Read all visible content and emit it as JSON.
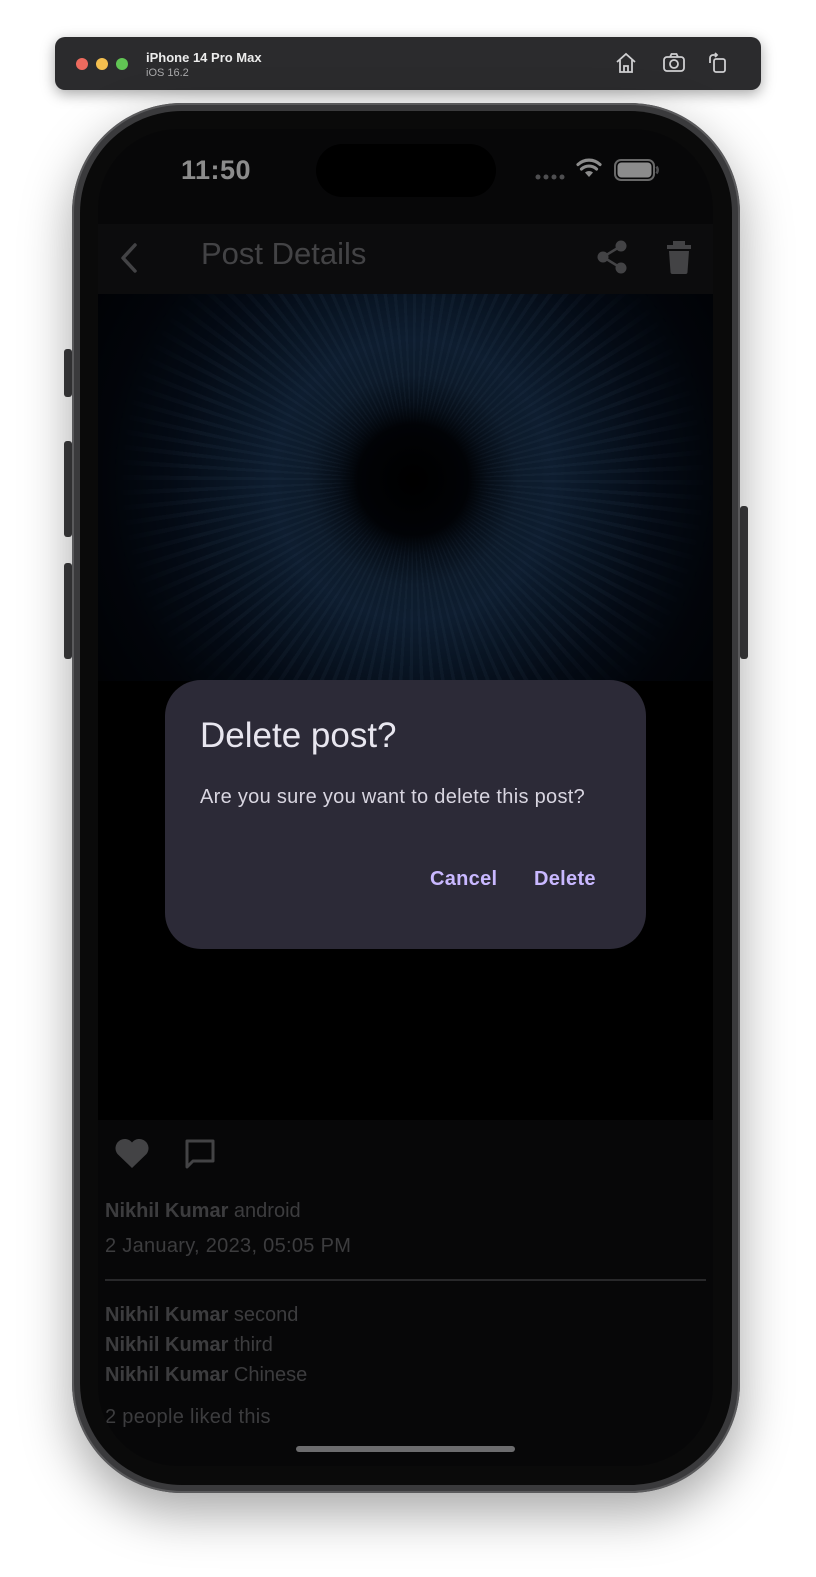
{
  "simulator": {
    "device_name": "iPhone 14 Pro Max",
    "os_version": "iOS 16.2",
    "icons": [
      "home-icon",
      "screenshot-icon",
      "rotate-icon"
    ]
  },
  "status_bar": {
    "time": "11:50",
    "icons": [
      "signal-dots-icon",
      "wifi-icon",
      "battery-icon"
    ]
  },
  "app_bar": {
    "title": "Post Details",
    "icons": [
      "back-icon",
      "share-icon",
      "trash-icon"
    ]
  },
  "post": {
    "caption_author": "Nikhil Kumar",
    "caption_text": " android",
    "date": "2 January, 2023, 05:05 PM",
    "comments": [
      {
        "author": "Nikhil Kumar",
        "text": " second"
      },
      {
        "author": "Nikhil Kumar",
        "text": " third"
      },
      {
        "author": "Nikhil Kumar",
        "text": " Chinese"
      }
    ],
    "likes_text": "2 people liked this",
    "action_icons": [
      "heart-icon",
      "comment-icon"
    ]
  },
  "dialog": {
    "title": "Delete post?",
    "message": "Are you sure you want to delete this post?",
    "cancel_label": "Cancel",
    "delete_label": "Delete"
  },
  "colors": {
    "dialog_bg": "#2c2a37",
    "dialog_button": "#c9b8ff",
    "screen_bg": "#0e0e10"
  }
}
